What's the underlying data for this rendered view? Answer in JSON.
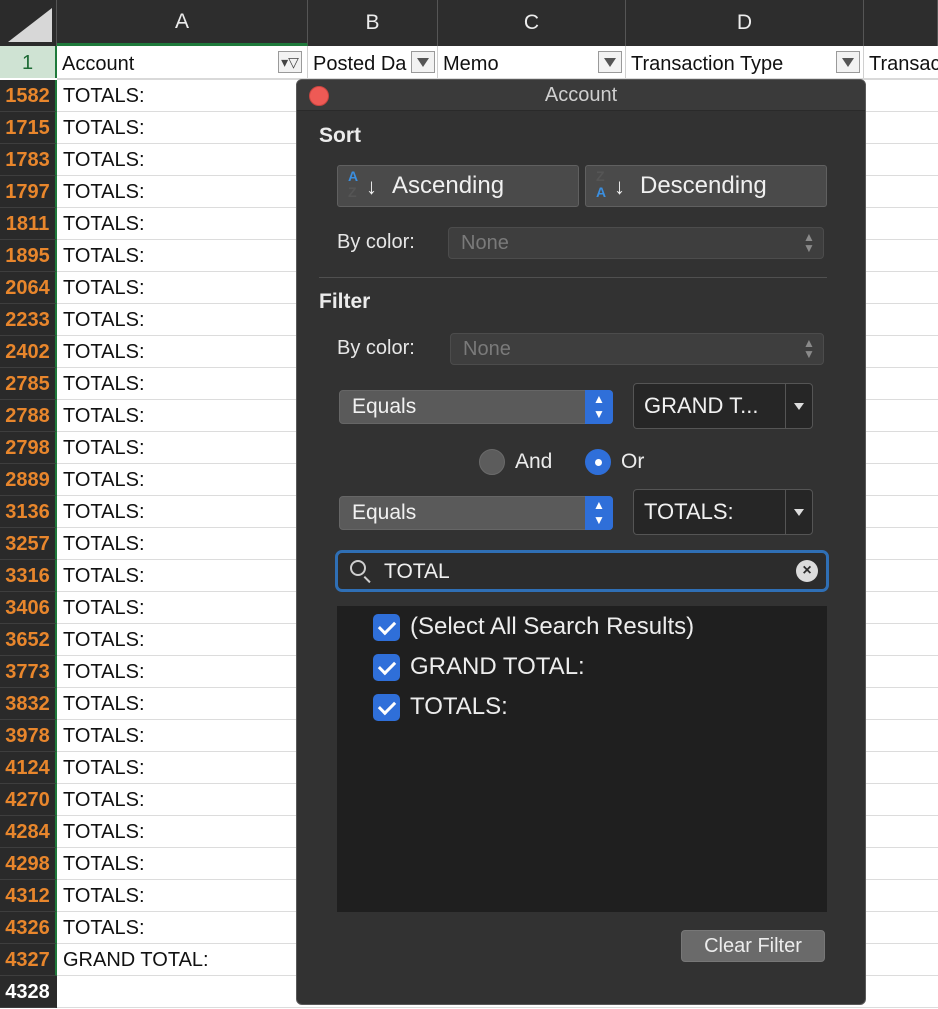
{
  "columns": {
    "A": "A",
    "B": "B",
    "C": "C",
    "D": "D"
  },
  "header_row": {
    "number": "1",
    "cells": [
      "Account",
      "Posted Da",
      "Memo",
      "Transaction Type",
      "Transac"
    ]
  },
  "rows": [
    {
      "num": "1582",
      "value": "TOTALS:"
    },
    {
      "num": "1715",
      "value": "TOTALS:"
    },
    {
      "num": "1783",
      "value": "TOTALS:"
    },
    {
      "num": "1797",
      "value": "TOTALS:"
    },
    {
      "num": "1811",
      "value": "TOTALS:"
    },
    {
      "num": "1895",
      "value": "TOTALS:"
    },
    {
      "num": "2064",
      "value": "TOTALS:"
    },
    {
      "num": "2233",
      "value": "TOTALS:"
    },
    {
      "num": "2402",
      "value": "TOTALS:"
    },
    {
      "num": "2785",
      "value": "TOTALS:"
    },
    {
      "num": "2788",
      "value": "TOTALS:"
    },
    {
      "num": "2798",
      "value": "TOTALS:"
    },
    {
      "num": "2889",
      "value": "TOTALS:"
    },
    {
      "num": "3136",
      "value": "TOTALS:"
    },
    {
      "num": "3257",
      "value": "TOTALS:"
    },
    {
      "num": "3316",
      "value": "TOTALS:"
    },
    {
      "num": "3406",
      "value": "TOTALS:"
    },
    {
      "num": "3652",
      "value": "TOTALS:"
    },
    {
      "num": "3773",
      "value": "TOTALS:"
    },
    {
      "num": "3832",
      "value": "TOTALS:"
    },
    {
      "num": "3978",
      "value": "TOTALS:"
    },
    {
      "num": "4124",
      "value": "TOTALS:"
    },
    {
      "num": "4270",
      "value": "TOTALS:"
    },
    {
      "num": "4284",
      "value": "TOTALS:"
    },
    {
      "num": "4298",
      "value": "TOTALS:"
    },
    {
      "num": "4312",
      "value": "TOTALS:"
    },
    {
      "num": "4326",
      "value": "TOTALS:"
    },
    {
      "num": "4327",
      "value": "GRAND TOTAL:"
    },
    {
      "num": "4328",
      "value": ""
    }
  ],
  "popover": {
    "title": "Account",
    "sort_heading": "Sort",
    "ascending_label": "Ascending",
    "descending_label": "Descending",
    "sort_by_color_label": "By color:",
    "sort_by_color_value": "None",
    "filter_heading": "Filter",
    "filter_by_color_label": "By color:",
    "filter_by_color_value": "None",
    "condition1_operator": "Equals",
    "condition1_value": "GRAND T...",
    "and_label": "And",
    "or_label": "Or",
    "logic_selected": "Or",
    "condition2_operator": "Equals",
    "condition2_value": "TOTALS:",
    "search_value": "TOTAL",
    "list_items": [
      "(Select All Search Results)",
      "GRAND TOTAL:",
      "TOTALS:"
    ],
    "clear_filter_label": "Clear Filter"
  },
  "colors": {
    "accent_blue": "#2f6fd9",
    "row_number_orange": "#e8862c",
    "selection_green": "#1f7a3b",
    "close_red": "#ee5a55"
  },
  "icons": {
    "sort_ascending": "sort-az-icon",
    "sort_descending": "sort-za-icon",
    "search": "search-icon",
    "clear": "clear-circle-icon",
    "checkbox": "checkmark-icon",
    "filter_active": "filter-funnel-icon"
  }
}
